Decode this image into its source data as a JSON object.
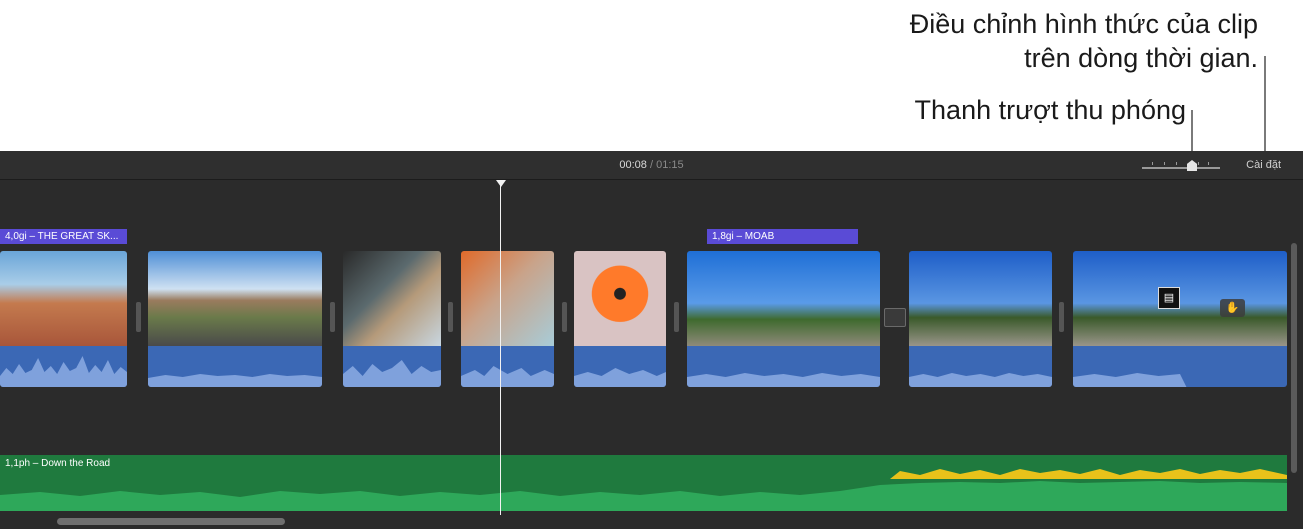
{
  "callouts": {
    "appearance_line1": "Điều chỉnh hình thức của clip",
    "appearance_line2": "trên dòng thời gian.",
    "zoom_slider": "Thanh trượt thu phóng"
  },
  "timeline": {
    "current_time": "00:08",
    "separator": "/",
    "total_time": "01:15",
    "settings_label": "Cài đặt"
  },
  "clip_titles": {
    "first": "4,0gi – THE GREAT SK...",
    "moab": "1,8gi – MOAB"
  },
  "music": {
    "label": "1,1ph – Down the Road"
  },
  "icons": {
    "transition": "transition-icon",
    "hand": "hand-icon",
    "film": "film-clip-icon"
  },
  "colors": {
    "timeline_bg": "#2b2b2b",
    "audio_blue": "#3b68b5",
    "title_purple": "#5a4bd6",
    "music_green": "#1f7a3e",
    "music_peak_yellow": "#e8c21a"
  }
}
